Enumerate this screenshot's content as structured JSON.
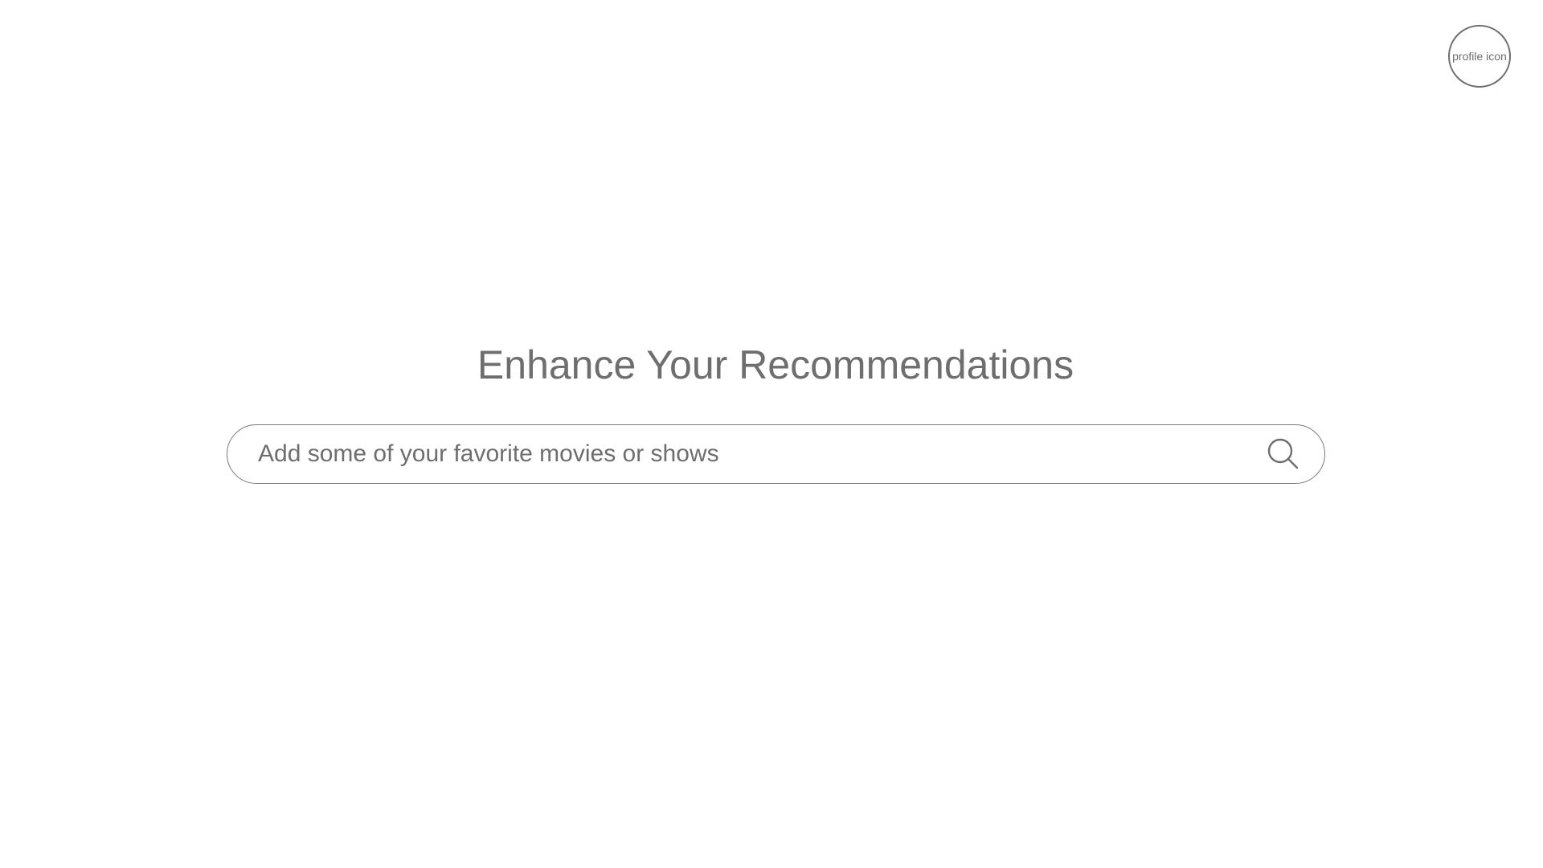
{
  "profile": {
    "label": "profile icon"
  },
  "main": {
    "title": "Enhance Your Recommendations"
  },
  "search": {
    "placeholder": "Add some of your favorite movies or shows",
    "value": ""
  }
}
